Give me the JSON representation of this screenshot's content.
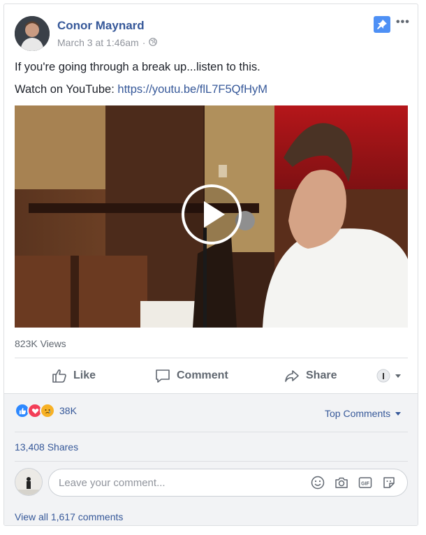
{
  "post": {
    "author": "Conor Maynard",
    "timestamp": "March 3 at 1:46am",
    "separator": "·",
    "privacy_icon": "globe-icon",
    "line1": "If you're going through a break up...listen to this.",
    "line2_prefix": "Watch on YouTube: ",
    "line2_link": "https://youtu.be/flL7F5QfHyM",
    "more_label": "•••",
    "views": "823K Views"
  },
  "actions": {
    "like": "Like",
    "comment": "Comment",
    "share": "Share"
  },
  "reactions": {
    "count": "38K",
    "types": [
      "like-reaction-icon",
      "love-reaction-icon",
      "sad-reaction-icon"
    ],
    "top_comments": "Top Comments",
    "shares": "13,408 Shares"
  },
  "comment_box": {
    "placeholder": "Leave your comment...",
    "view_all": "View all 1,617 comments"
  },
  "colors": {
    "link": "#365899",
    "pin_blue": "#4e90f5",
    "like_blue": "#2d88ff",
    "love_red": "#f33e58",
    "sad_yellow": "#f7b125"
  }
}
